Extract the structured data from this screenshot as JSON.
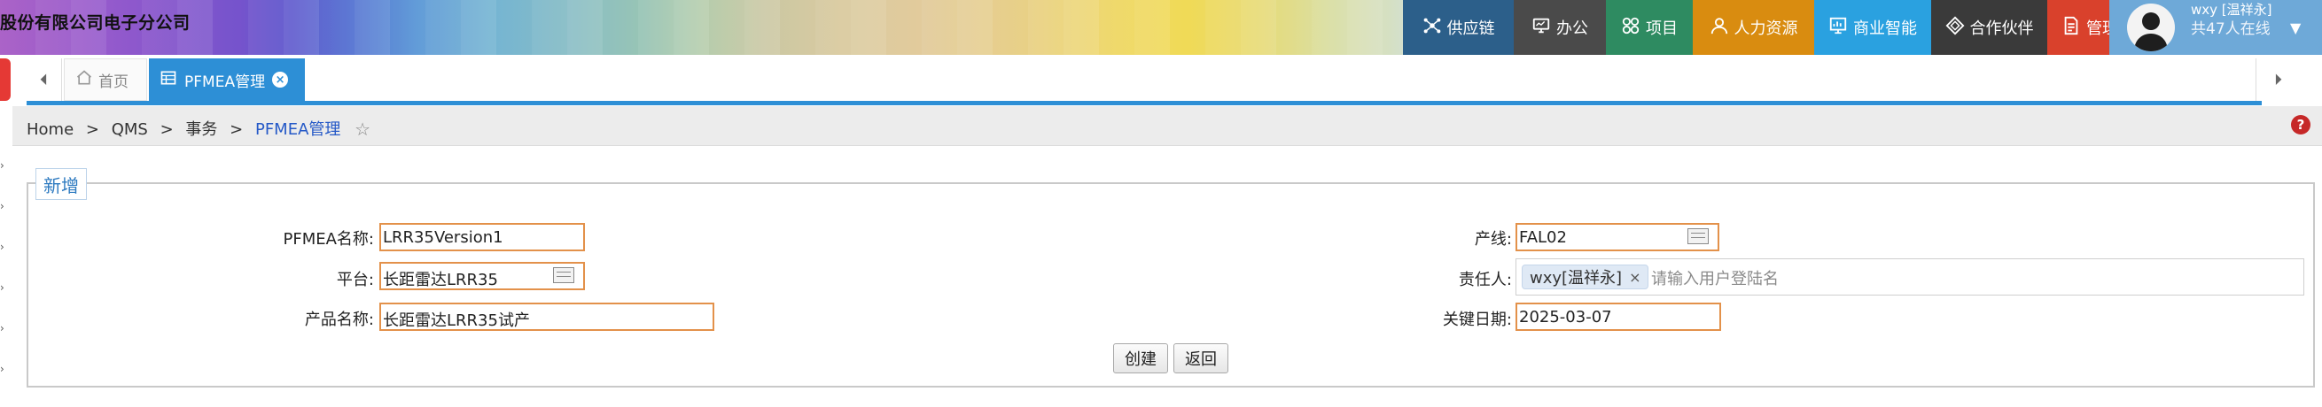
{
  "header": {
    "company": "股份有限公司电子分公司",
    "menu": [
      {
        "label": "供应链",
        "icon": "network-icon",
        "color": "#2c5f8a"
      },
      {
        "label": "办公",
        "icon": "monitor-icon",
        "color": "#4a4a4a"
      },
      {
        "label": "项目",
        "icon": "grid-icon",
        "color": "#2e8b61"
      },
      {
        "label": "人力资源",
        "icon": "person-icon",
        "color": "#d98c10"
      },
      {
        "label": "商业智能",
        "icon": "chart-icon",
        "color": "#2aa1e0"
      },
      {
        "label": "合作伙伴",
        "icon": "diamond-icon",
        "color": "#3a3a3a"
      },
      {
        "label": "管理",
        "icon": "document-icon",
        "color": "#d9412c"
      }
    ],
    "user": {
      "name": "wxy [温祥永]",
      "online": "共47人在线"
    }
  },
  "tabs": {
    "home": "首页",
    "active": "PFMEA管理"
  },
  "breadcrumb": {
    "home": "Home",
    "qms": "QMS",
    "section": "事务",
    "current": "PFMEA管理",
    "separator": ">"
  },
  "form": {
    "legend": "新增",
    "fields": {
      "pfmea_name": {
        "label": "PFMEA名称:",
        "value": "LRR35Version1"
      },
      "platform": {
        "label": "平台:",
        "value": "长距雷达LRR35"
      },
      "product_name": {
        "label": "产品名称:",
        "value": "长距雷达LRR35试产"
      },
      "line": {
        "label": "产线:",
        "value": "FAL02"
      },
      "owner": {
        "label": "责任人:",
        "chip": "wxy[温祥永]",
        "placeholder": "请输入用户登陆名"
      },
      "key_date": {
        "label": "关键日期:",
        "value": "2025-03-07"
      }
    },
    "buttons": {
      "create": "创建",
      "back": "返回"
    }
  },
  "colors": {
    "accent": "#2d8fd6",
    "input_border": "#e3914a",
    "link": "#2559c7"
  }
}
